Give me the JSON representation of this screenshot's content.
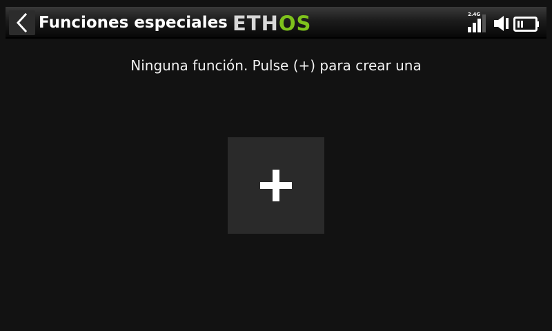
{
  "header": {
    "back_icon": "chevron-left-icon",
    "title": "Funciones especiales",
    "logo": {
      "part1": "ETH",
      "part2": "OS"
    },
    "status": {
      "rf_band": "2.4G",
      "signal_icon": "signal-bars-icon",
      "volume_icon": "speaker-icon",
      "battery_icon": "battery-icon"
    }
  },
  "main": {
    "empty_message": "Ninguna función. Pulse (+) para crear una",
    "add_button_icon": "plus-icon"
  },
  "colors": {
    "background": "#121212",
    "header_gradient_top": "#3a3a3a",
    "header_gradient_bottom": "#070707",
    "logo_accent": "#7ec21c",
    "button_bg": "#2a2a2a",
    "text": "#f2f2f2"
  }
}
